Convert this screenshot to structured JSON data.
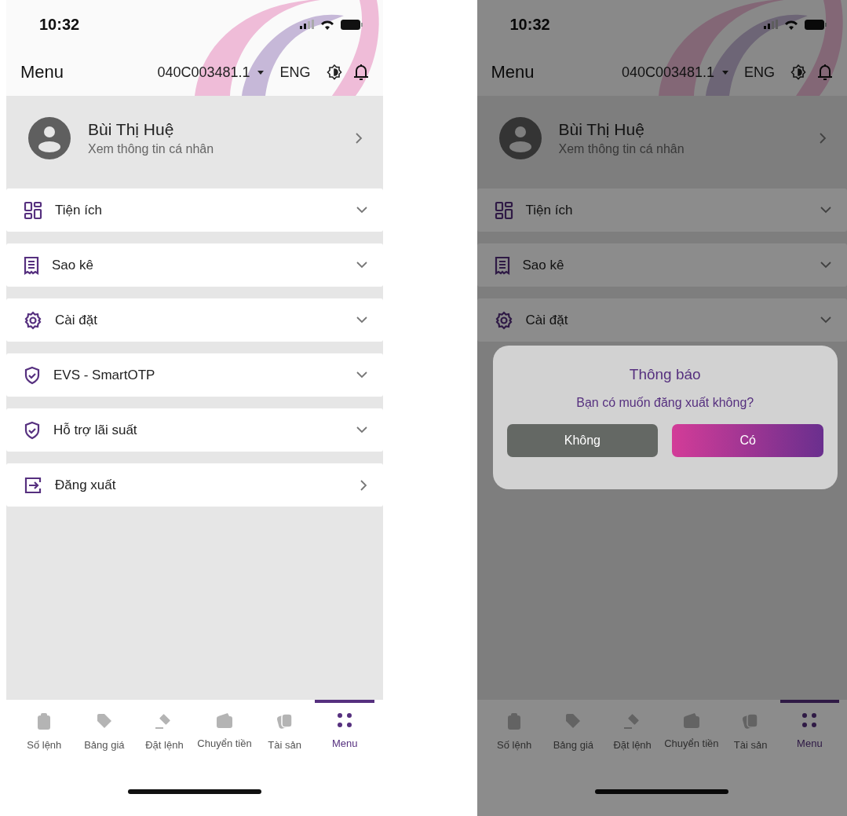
{
  "screens": [
    {
      "status_bar": {
        "time": "10:32"
      },
      "header": {
        "title": "Menu",
        "account": "040C003481.1",
        "language": "ENG"
      },
      "profile": {
        "name": "Bùi Thị Huệ",
        "subtitle": "Xem thông tin cá nhân"
      },
      "menu_items": [
        {
          "label": "Tiện ích",
          "kind": "grid"
        },
        {
          "label": "Sao kê",
          "kind": "receipt"
        },
        {
          "label": "Cài đặt",
          "kind": "gear"
        },
        {
          "label": "EVS - SmartOTP",
          "kind": "shield"
        },
        {
          "label": "Hỗ trợ lãi suất",
          "kind": "shield"
        },
        {
          "label": "Đăng xuất",
          "kind": "logout"
        }
      ],
      "nav": [
        {
          "label": "Số lệnh",
          "selected": false
        },
        {
          "label": "Bảng giá",
          "selected": false
        },
        {
          "label": "Đặt lệnh",
          "selected": false
        },
        {
          "label": "Chuyển tiền",
          "selected": false
        },
        {
          "label": "Tài sản",
          "selected": false
        },
        {
          "label": "Menu",
          "selected": true
        }
      ]
    },
    {
      "status_bar": {
        "time": "10:32"
      },
      "header": {
        "title": "Menu",
        "account": "040C003481.1",
        "language": "ENG"
      },
      "profile": {
        "name": "Bùi Thị Huệ",
        "subtitle": "Xem thông tin cá nhân"
      },
      "menu_items": [
        {
          "label": "Tiện ích",
          "kind": "grid"
        },
        {
          "label": "Sao kê",
          "kind": "receipt"
        },
        {
          "label": "Cài đặt",
          "kind": "gear"
        }
      ],
      "nav": [
        {
          "label": "Số lệnh",
          "selected": false
        },
        {
          "label": "Bảng giá",
          "selected": false
        },
        {
          "label": "Đặt lệnh",
          "selected": false
        },
        {
          "label": "Chuyển tiền",
          "selected": false
        },
        {
          "label": "Tài sản",
          "selected": false
        },
        {
          "label": "Menu",
          "selected": true
        }
      ],
      "dialog": {
        "title": "Thông báo",
        "message": "Bạn có muốn đăng xuất không?",
        "buttons": [
          {
            "label": "Không",
            "kind": "cancel"
          },
          {
            "label": "Có",
            "kind": "confirm"
          }
        ]
      }
    }
  ]
}
